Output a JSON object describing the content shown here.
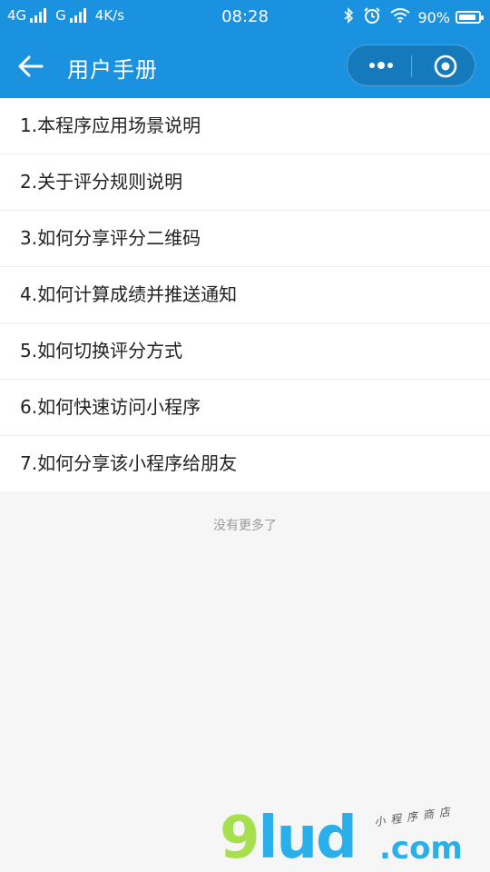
{
  "status_bar": {
    "network1": "4G",
    "network2": "G",
    "speed": "4K/s",
    "time": "08:28",
    "battery_pct": "90%",
    "battery_level": 0.9,
    "icons": [
      "bluetooth-icon",
      "alarm-icon",
      "wifi-icon",
      "battery-icon"
    ]
  },
  "nav": {
    "title": "用户手册",
    "back_icon": "arrow-left-icon",
    "more_icon": "more-dots-icon",
    "close_icon": "target-close-icon"
  },
  "menu": {
    "items": [
      "1.本程序应用场景说明",
      "2.关于评分规则说明",
      "3.如何分享评分二维码",
      "4.如何计算成绩并推送通知",
      "5.如何切换评分方式",
      "6.如何快速访问小程序",
      "7.如何分享该小程序给朋友"
    ]
  },
  "footer": {
    "no_more": "没有更多了"
  },
  "watermark": {
    "logo_g": "9",
    "logo_rest": "lud",
    "tagline": "小程序商店",
    "suffix": ".com"
  },
  "colors": {
    "brand_blue": "#1a92e0",
    "watermark_green": "#a7e04e",
    "watermark_blue": "#29b0ea"
  }
}
